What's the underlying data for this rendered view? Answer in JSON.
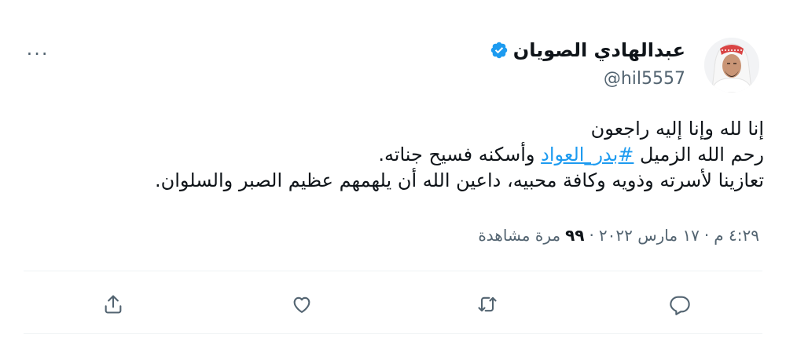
{
  "tweet": {
    "author": {
      "display_name": "عبدالهادي الصويان",
      "handle": "@hil5557",
      "verified": true
    },
    "text_lines": {
      "line1": "إنا لله وإنا إليه راجعون",
      "line2_before": "رحم الله الزميل ",
      "line2_hashtag": "#بدر_العواد",
      "line2_after": " وأسكنه فسيح جناته.",
      "line3": "تعازينا لأسرته وذويه وكافة محبيه، داعين الله أن يلهمهم عظيم الصبر والسلوان."
    },
    "meta": {
      "time": "٤:٢٩ م",
      "sep1": "·",
      "date": "١٧ مارس ٢٠٢٢",
      "sep2": "·",
      "views": "٩٩",
      "views_label": "مرة مشاهدة"
    },
    "more_label": "···"
  },
  "icons": {
    "verified": "verified-badge-icon",
    "more": "more-icon",
    "reply": "reply-icon",
    "retweet": "retweet-icon",
    "like": "heart-icon",
    "share": "share-icon"
  },
  "colors": {
    "accent": "#1d9bf0",
    "secondary_text": "#536471",
    "icon": "#536471",
    "divider": "#eff3f4"
  }
}
